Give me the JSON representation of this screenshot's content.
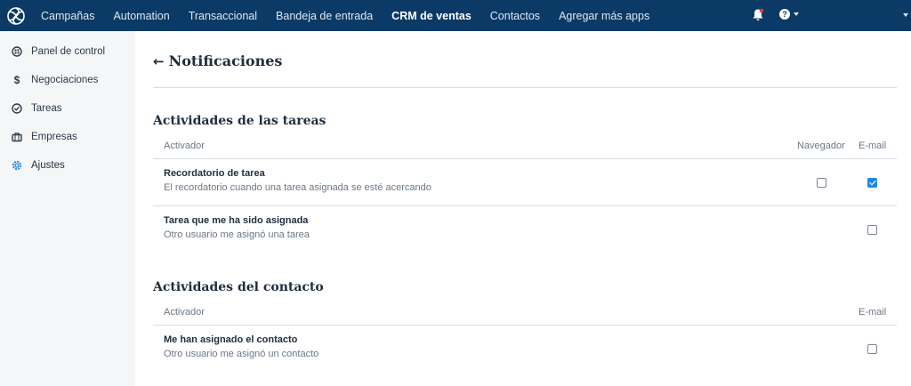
{
  "topnav": {
    "items": [
      "Campañas",
      "Automation",
      "Transaccional",
      "Bandeja de entrada",
      "CRM de ventas",
      "Contactos",
      "Agregar más apps"
    ],
    "active_index": 4,
    "help_glyph": "?"
  },
  "sidebar": {
    "items": [
      {
        "label": "Panel de control",
        "icon": "dashboard-icon"
      },
      {
        "label": "Negociaciones",
        "icon": "dollar-icon"
      },
      {
        "label": "Tareas",
        "icon": "check-circle-icon"
      },
      {
        "label": "Empresas",
        "icon": "briefcase-icon"
      },
      {
        "label": "Ajustes",
        "icon": "gear-icon",
        "active": true
      }
    ]
  },
  "page": {
    "back_glyph": "←",
    "title": "Notificaciones"
  },
  "sections": [
    {
      "title": "Actividades de las tareas",
      "header_label": "Activador",
      "col_browser": "Navegador",
      "col_email": "E-mail",
      "rows": [
        {
          "title": "Recordatorio de tarea",
          "description": "El recordatorio cuando una tarea asignada se esté acercando",
          "browser_checked": false,
          "email_checked": true
        },
        {
          "title": "Tarea que me ha sido asignada",
          "description": "Otro usuario me asignó una tarea",
          "email_checked": false
        }
      ]
    },
    {
      "title": "Actividades del contacto",
      "header_label": "Activador",
      "col_email": "E-mail",
      "rows": [
        {
          "title": "Me han asignado el contacto",
          "description": "Otro usuario me asignó un contacto",
          "email_checked": false
        }
      ]
    }
  ],
  "colors": {
    "topbar": "#0b3a66",
    "sidebar_bg": "#f5f6f7",
    "accent": "#1e88e5",
    "notification_dot": "#e53935"
  }
}
